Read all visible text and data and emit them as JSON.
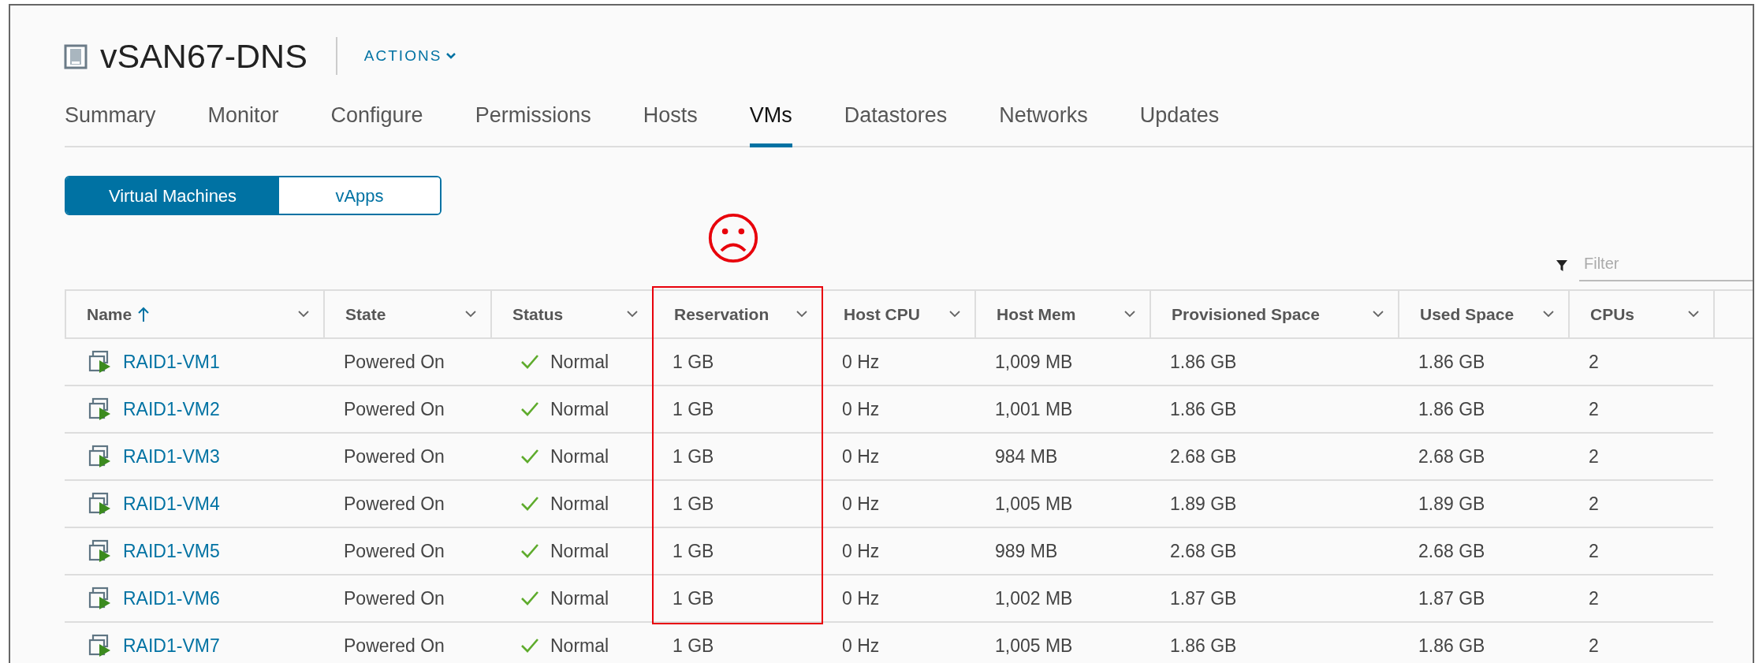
{
  "header": {
    "title": "vSAN67-DNS",
    "actions": "ACTIONS"
  },
  "tabs": [
    {
      "label": "Summary",
      "selected": false
    },
    {
      "label": "Monitor",
      "selected": false
    },
    {
      "label": "Configure",
      "selected": false
    },
    {
      "label": "Permissions",
      "selected": false
    },
    {
      "label": "Hosts",
      "selected": false
    },
    {
      "label": "VMs",
      "selected": true
    },
    {
      "label": "Datastores",
      "selected": false
    },
    {
      "label": "Networks",
      "selected": false
    },
    {
      "label": "Updates",
      "selected": false
    }
  ],
  "view_toggle": [
    {
      "label": "Virtual Machines",
      "selected": true
    },
    {
      "label": "vApps",
      "selected": false
    }
  ],
  "filter": {
    "placeholder": "Filter"
  },
  "table": {
    "columns": [
      {
        "label": "Name",
        "sorted": true,
        "highlighted": false
      },
      {
        "label": "State",
        "sorted": false,
        "highlighted": false
      },
      {
        "label": "Status",
        "sorted": false,
        "highlighted": false
      },
      {
        "label": "Reservation",
        "sorted": false,
        "highlighted": true
      },
      {
        "label": "Host CPU",
        "sorted": false,
        "highlighted": false
      },
      {
        "label": "Host Mem",
        "sorted": false,
        "highlighted": false
      },
      {
        "label": "Provisioned Space",
        "sorted": false,
        "highlighted": false
      },
      {
        "label": "Used Space",
        "sorted": false,
        "highlighted": false
      },
      {
        "label": "CPUs",
        "sorted": false,
        "highlighted": false
      }
    ],
    "rows": [
      {
        "cells": [
          "RAID1-VM1",
          "Powered On",
          "Normal",
          "1 GB",
          "0 Hz",
          "1,009 MB",
          "1.86 GB",
          "1.86 GB",
          "2"
        ]
      },
      {
        "cells": [
          "RAID1-VM2",
          "Powered On",
          "Normal",
          "1 GB",
          "0 Hz",
          "1,001 MB",
          "1.86 GB",
          "1.86 GB",
          "2"
        ]
      },
      {
        "cells": [
          "RAID1-VM3",
          "Powered On",
          "Normal",
          "1 GB",
          "0 Hz",
          "984 MB",
          "2.68 GB",
          "2.68 GB",
          "2"
        ]
      },
      {
        "cells": [
          "RAID1-VM4",
          "Powered On",
          "Normal",
          "1 GB",
          "0 Hz",
          "1,005 MB",
          "1.89 GB",
          "1.89 GB",
          "2"
        ]
      },
      {
        "cells": [
          "RAID1-VM5",
          "Powered On",
          "Normal",
          "1 GB",
          "0 Hz",
          "989 MB",
          "2.68 GB",
          "2.68 GB",
          "2"
        ]
      },
      {
        "cells": [
          "RAID1-VM6",
          "Powered On",
          "Normal",
          "1 GB",
          "0 Hz",
          "1,002 MB",
          "1.87 GB",
          "1.87 GB",
          "2"
        ]
      },
      {
        "cells": [
          "RAID1-VM7",
          "Powered On",
          "Normal",
          "1 GB",
          "0 Hz",
          "1,005 MB",
          "1.86 GB",
          "1.86 GB",
          "2"
        ]
      }
    ]
  }
}
